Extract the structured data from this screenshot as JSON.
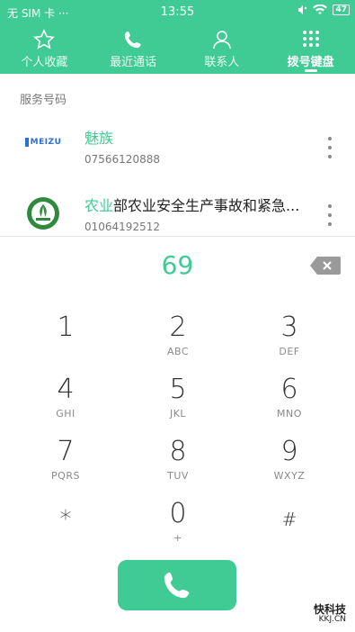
{
  "status_bar": {
    "carrier": "无 SIM 卡 ···",
    "time": "13:55",
    "battery": "47"
  },
  "tabs": [
    {
      "label": "个人收藏",
      "icon": "star-icon"
    },
    {
      "label": "最近通话",
      "icon": "phone-icon"
    },
    {
      "label": "联系人",
      "icon": "person-icon"
    },
    {
      "label": "拨号键盘",
      "icon": "dialpad-icon",
      "active": true
    }
  ],
  "section_title": "服务号码",
  "contacts": [
    {
      "logo_text": "MEIZU",
      "name_highlight": "魅族",
      "name_rest": "",
      "number": "07566120888"
    },
    {
      "logo_text": "",
      "name_highlight": "农业",
      "name_rest": "部农业安全生产事故和紧急...",
      "number": "01064192512"
    }
  ],
  "dial_entry": "69",
  "keypad": [
    {
      "digit": "1",
      "letters": ""
    },
    {
      "digit": "2",
      "letters": "ABC"
    },
    {
      "digit": "3",
      "letters": "DEF"
    },
    {
      "digit": "4",
      "letters": "GHI"
    },
    {
      "digit": "5",
      "letters": "JKL"
    },
    {
      "digit": "6",
      "letters": "MNO"
    },
    {
      "digit": "7",
      "letters": "PQRS"
    },
    {
      "digit": "8",
      "letters": "TUV"
    },
    {
      "digit": "9",
      "letters": "WXYZ"
    },
    {
      "digit": "*",
      "letters": ""
    },
    {
      "digit": "0",
      "letters": "+"
    },
    {
      "digit": "#",
      "letters": ""
    }
  ],
  "watermark": {
    "title": "快科技",
    "subtitle": "KKJ.CN"
  },
  "colors": {
    "accent": "#3fcb93"
  }
}
